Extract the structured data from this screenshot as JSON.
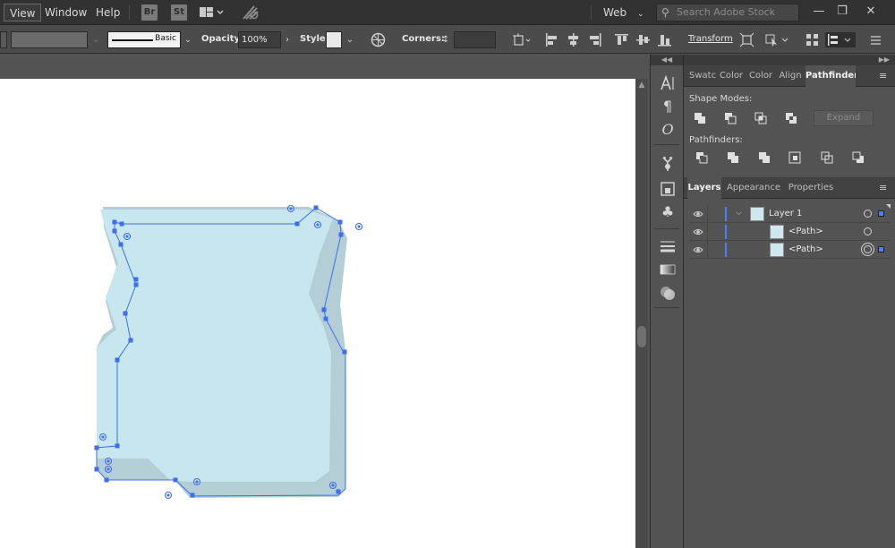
{
  "menubar": {
    "items": [
      "View",
      "Window",
      "Help"
    ],
    "badges": [
      "Br",
      "St"
    ],
    "workspace": "Web",
    "search_placeholder": "Search Adobe Stock"
  },
  "controlbar": {
    "stroke_style": "Basic",
    "opacity_label": "Opacity:",
    "opacity_value": "100%",
    "style_label": "Style:",
    "corners_label": "Corners:",
    "transform_label": "Transform"
  },
  "pathfinder": {
    "tabs": [
      "Swatc",
      "Color",
      "Color",
      "Align",
      "Pathfinder"
    ],
    "shape_modes_title": "Shape Modes:",
    "pathfinders_title": "Pathfinders:",
    "expand_label": "Expand"
  },
  "layers": {
    "tabs": [
      "Layers",
      "Appearance",
      "Properties"
    ],
    "rows": [
      {
        "name": "Layer 1"
      },
      {
        "name": "<Path>"
      },
      {
        "name": "<Path>"
      }
    ]
  },
  "colors": {
    "accent": "#4f7cff",
    "shape_fill": "#c8e6ee",
    "shape_shadow": "#b4ced6",
    "anchor": "#3d6ef0"
  }
}
